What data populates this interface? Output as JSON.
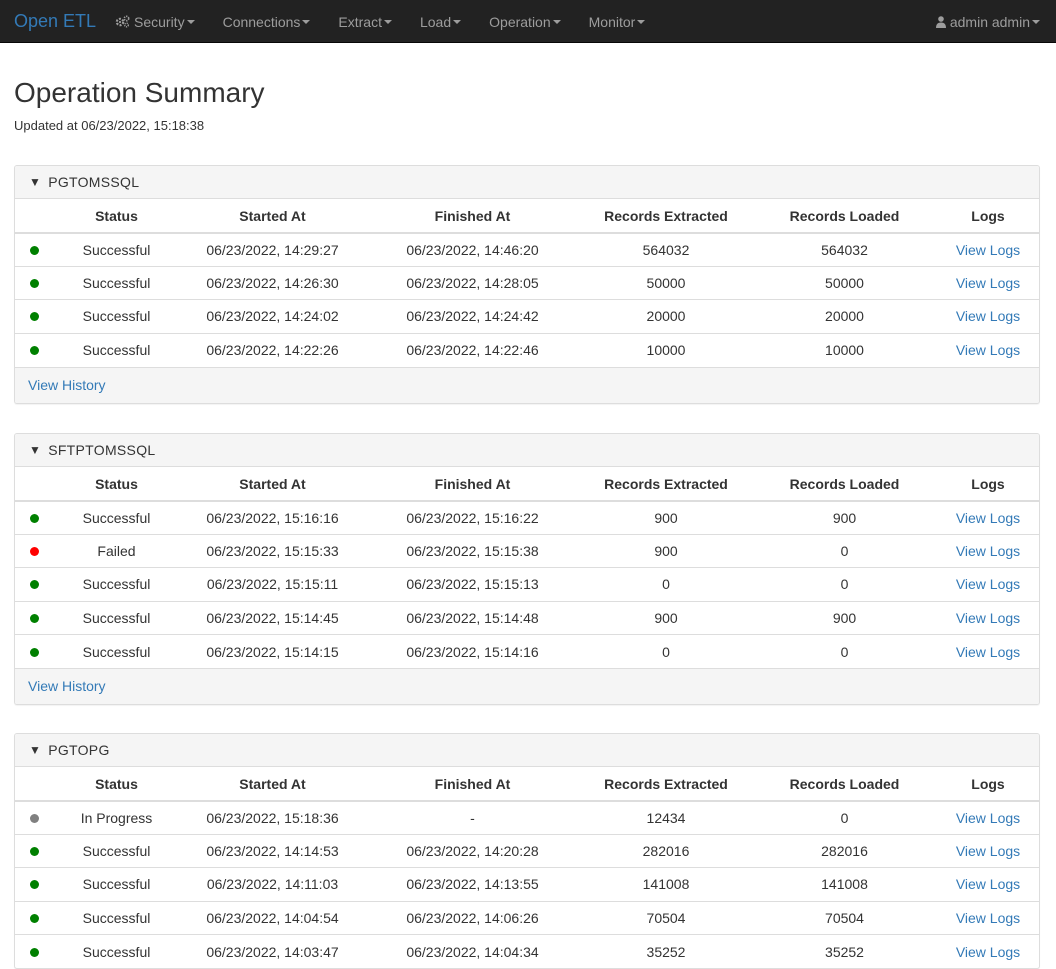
{
  "navbar": {
    "brand": "Open ETL",
    "menus": [
      "Security",
      "Connections",
      "Extract",
      "Load",
      "Operation",
      "Monitor"
    ],
    "user": "admin admin"
  },
  "page": {
    "title": "Operation Summary",
    "updated": "Updated at 06/23/2022, 15:18:38"
  },
  "columns": [
    "Status",
    "Started At",
    "Finished At",
    "Records Extracted",
    "Records Loaded",
    "Logs"
  ],
  "status_colors": {
    "Successful": "#008000",
    "Failed": "#ff0000",
    "In Progress": "#808080"
  },
  "panels": [
    {
      "name": "PGTOMSSQL",
      "rows": [
        {
          "status": "Successful",
          "started": "06/23/2022, 14:29:27",
          "finished": "06/23/2022, 14:46:20",
          "extracted": "564032",
          "loaded": "564032",
          "logs": "View Logs"
        },
        {
          "status": "Successful",
          "started": "06/23/2022, 14:26:30",
          "finished": "06/23/2022, 14:28:05",
          "extracted": "50000",
          "loaded": "50000",
          "logs": "View Logs"
        },
        {
          "status": "Successful",
          "started": "06/23/2022, 14:24:02",
          "finished": "06/23/2022, 14:24:42",
          "extracted": "20000",
          "loaded": "20000",
          "logs": "View Logs"
        },
        {
          "status": "Successful",
          "started": "06/23/2022, 14:22:26",
          "finished": "06/23/2022, 14:22:46",
          "extracted": "10000",
          "loaded": "10000",
          "logs": "View Logs"
        }
      ],
      "footer": "View History"
    },
    {
      "name": "SFTPTOMSSQL",
      "rows": [
        {
          "status": "Successful",
          "started": "06/23/2022, 15:16:16",
          "finished": "06/23/2022, 15:16:22",
          "extracted": "900",
          "loaded": "900",
          "logs": "View Logs"
        },
        {
          "status": "Failed",
          "started": "06/23/2022, 15:15:33",
          "finished": "06/23/2022, 15:15:38",
          "extracted": "900",
          "loaded": "0",
          "logs": "View Logs"
        },
        {
          "status": "Successful",
          "started": "06/23/2022, 15:15:11",
          "finished": "06/23/2022, 15:15:13",
          "extracted": "0",
          "loaded": "0",
          "logs": "View Logs"
        },
        {
          "status": "Successful",
          "started": "06/23/2022, 15:14:45",
          "finished": "06/23/2022, 15:14:48",
          "extracted": "900",
          "loaded": "900",
          "logs": "View Logs"
        },
        {
          "status": "Successful",
          "started": "06/23/2022, 15:14:15",
          "finished": "06/23/2022, 15:14:16",
          "extracted": "0",
          "loaded": "0",
          "logs": "View Logs"
        }
      ],
      "footer": "View History"
    },
    {
      "name": "PGTOPG",
      "rows": [
        {
          "status": "In Progress",
          "started": "06/23/2022, 15:18:36",
          "finished": "-",
          "extracted": "12434",
          "loaded": "0",
          "logs": "View Logs"
        },
        {
          "status": "Successful",
          "started": "06/23/2022, 14:14:53",
          "finished": "06/23/2022, 14:20:28",
          "extracted": "282016",
          "loaded": "282016",
          "logs": "View Logs"
        },
        {
          "status": "Successful",
          "started": "06/23/2022, 14:11:03",
          "finished": "06/23/2022, 14:13:55",
          "extracted": "141008",
          "loaded": "141008",
          "logs": "View Logs"
        },
        {
          "status": "Successful",
          "started": "06/23/2022, 14:04:54",
          "finished": "06/23/2022, 14:06:26",
          "extracted": "70504",
          "loaded": "70504",
          "logs": "View Logs"
        },
        {
          "status": "Successful",
          "started": "06/23/2022, 14:03:47",
          "finished": "06/23/2022, 14:04:34",
          "extracted": "35252",
          "loaded": "35252",
          "logs": "View Logs"
        }
      ],
      "footer": null
    }
  ]
}
